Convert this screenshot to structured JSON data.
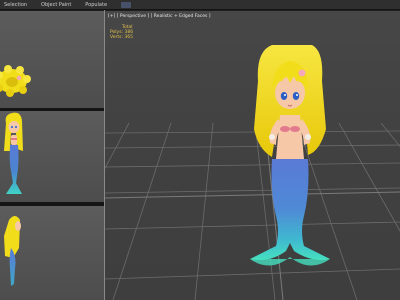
{
  "menu": {
    "items": [
      "Selection",
      "Object Paint",
      "Populate"
    ]
  },
  "viewports": {
    "perspective_label": "[+] [ Perspective ] [ Realistic + Edged Faces ]",
    "stats": {
      "header": "Total",
      "polys_label": "Polys:",
      "polys_value": "386",
      "verts_label": "Verts:",
      "verts_value": "365"
    }
  },
  "colors": {
    "hair": "#f2dd1a",
    "skin": "#f6c8a8",
    "tail_top": "#5a7ad6",
    "tail_bottom": "#3fd3c6",
    "grid_line": "#6a6a6a",
    "stats_text": "#e3c14a"
  },
  "icons": {
    "menu_icon": "viewport-toggle-icon"
  }
}
